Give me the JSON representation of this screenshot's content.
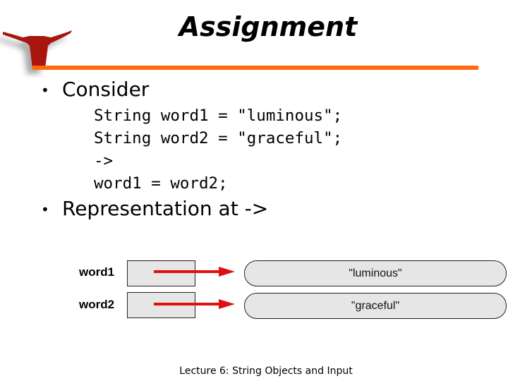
{
  "slide": {
    "title": "Assignment",
    "logo_icon": "longhorn-logo",
    "accent_color": "#ff6a10",
    "logo_color": "#a8160f",
    "bullets": [
      {
        "marker": "•",
        "text": "Consider"
      },
      {
        "marker": "•",
        "text": "Representation at ->"
      }
    ],
    "code_lines": [
      "String word1 = \"luminous\";",
      "String word2 = \"graceful\";",
      "->",
      "word1 = word2;"
    ],
    "diagram": {
      "rows": [
        {
          "variable": "word1",
          "value": "\"luminous\""
        },
        {
          "variable": "word2",
          "value": "\"graceful\""
        }
      ],
      "arrow_color": "#e01010",
      "box_fill": "#e6e6e6"
    },
    "footer": "Lecture 6: String Objects and Input"
  }
}
